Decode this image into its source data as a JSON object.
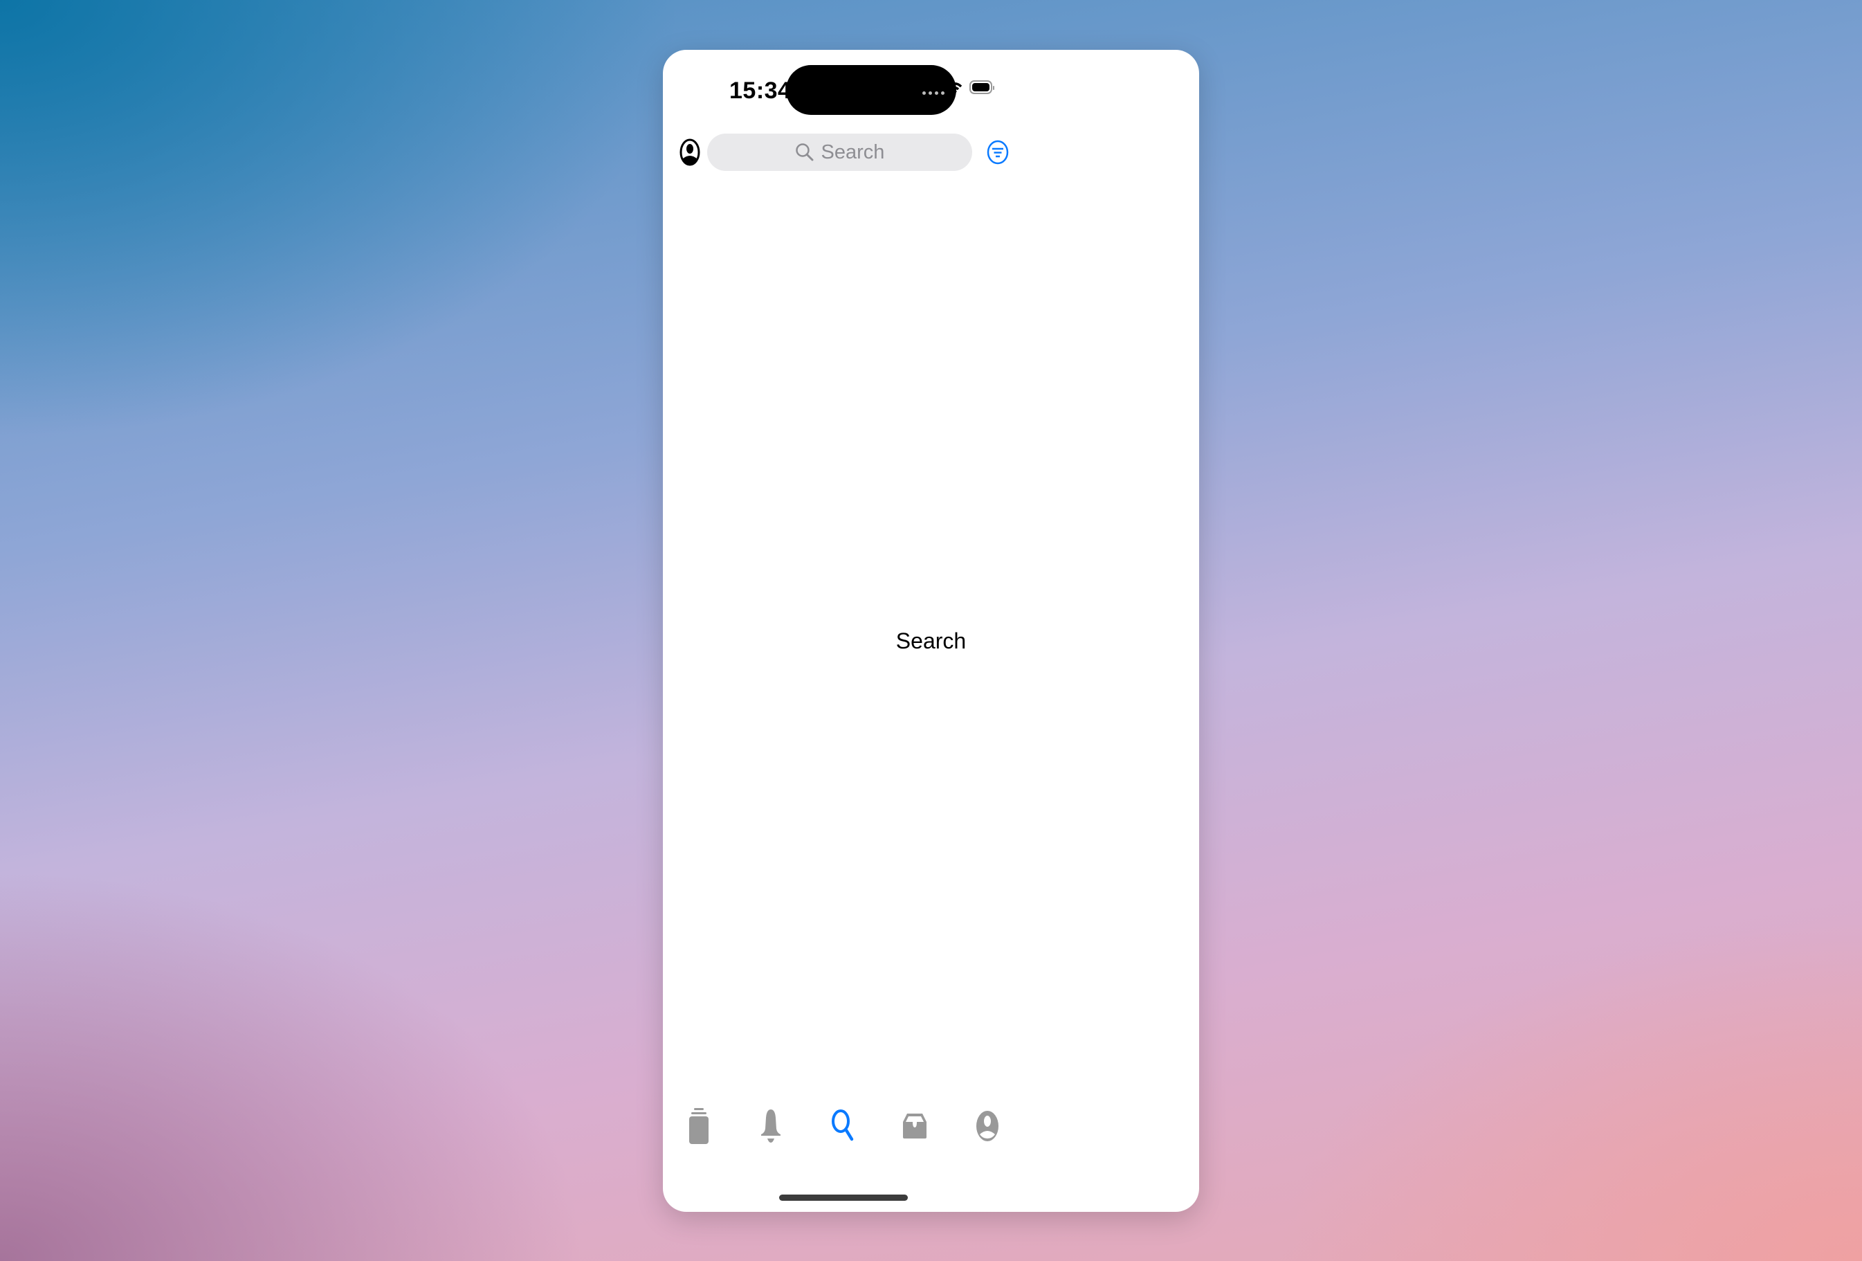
{
  "status_bar": {
    "time": "15:34"
  },
  "header": {
    "search_placeholder": "Search",
    "profile_icon": "person-circle-icon",
    "filter_icon": "filter-circle-icon"
  },
  "main": {
    "content_label": "Search"
  },
  "tab_bar": {
    "active": "search",
    "colors": {
      "active": "#0a7aff",
      "inactive": "#999999"
    },
    "items": [
      {
        "id": "feed",
        "icon": "stack-icon"
      },
      {
        "id": "notifications",
        "icon": "bell-icon"
      },
      {
        "id": "search",
        "icon": "magnifier-icon"
      },
      {
        "id": "inbox",
        "icon": "tray-icon"
      },
      {
        "id": "profile",
        "icon": "person-circle-icon"
      }
    ]
  }
}
